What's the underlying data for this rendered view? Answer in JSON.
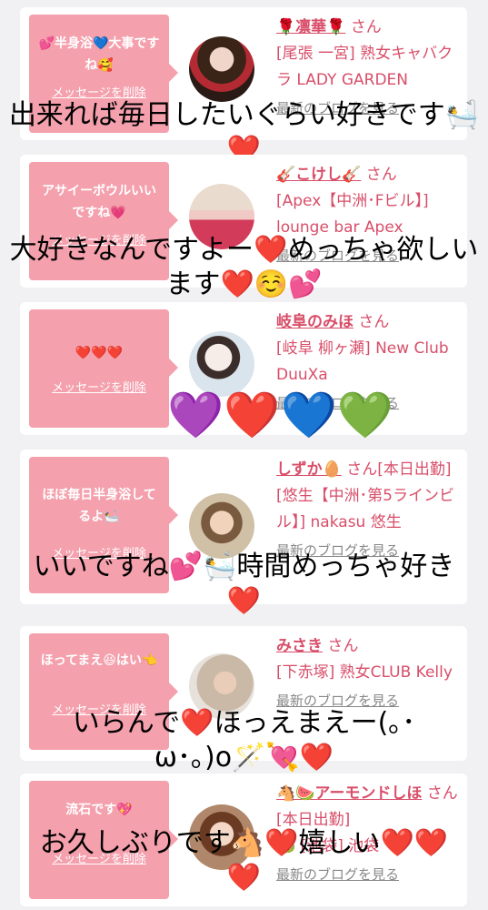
{
  "entries": [
    {
      "message": "💕半身浴💙大事ですね🥰",
      "delete_label": "メッセージを削除",
      "name": "🌹凛華🌹",
      "honorific": "さん",
      "shop": "[尾張 一宮] 熟女キャバクラ LADY GARDEN",
      "blog_label": "最新のブログを見る",
      "comment": "出来れば毎日したいぐらい好きです🛀❤️"
    },
    {
      "message": "アサイーボウルいいですね💗",
      "delete_label": "メッセージを削除",
      "name": "🎸こけし🎸",
      "honorific": "さん",
      "shop": "[Apex【中洲･Fビル】] lounge bar Apex",
      "blog_label": "最新のブログを見る",
      "comment": "大好きなんですよー❤️めっちゃ欲しいます❤️☺️💕"
    },
    {
      "message": "❤️❤️❤️",
      "delete_label": "メッセージを削除",
      "name": "岐阜のみほ",
      "honorific": "さん",
      "shop": "[岐阜 柳ヶ瀬] New Club DuuXa",
      "blog_label": "最新のブログを見る",
      "comment": "💜❤️💙💚"
    },
    {
      "message": "ほぼ毎日半身浴してるよ🛀",
      "delete_label": "メッセージを削除",
      "name": "しずか🥚",
      "honorific": "さん[本日出勤]",
      "shop": "[悠生【中洲･第5ラインビル】] nakasu 悠生",
      "blog_label": "最新のブログを見る",
      "comment": "いいですね💕🛀時間めっちゃ好き❤️"
    },
    {
      "message": "ほってまえ😆はい👈",
      "delete_label": "メッセージを削除",
      "name": "みさき",
      "honorific": "さん",
      "shop": "[下赤塚] 熟女CLUB Kelly",
      "blog_label": "最新のブログを見る",
      "comment": "いらんで❤️ほっえまえー(｡･ω･｡)o🪄💘❤️"
    },
    {
      "message": "流石です💖",
      "delete_label": "メッセージを削除",
      "name": "🐴🍉アーモンドしほ",
      "honorific": "さん[本日出勤]",
      "shop": "🍉 [池袋] 池袋",
      "blog_label": "最新のブログを見る",
      "comment": "お久しぶりです🐴❤️嬉しい❤️❤️❤️"
    }
  ],
  "colors": {
    "bubble": "#f4a0ad",
    "accent": "#d84e69",
    "background": "#f1f1f3"
  }
}
